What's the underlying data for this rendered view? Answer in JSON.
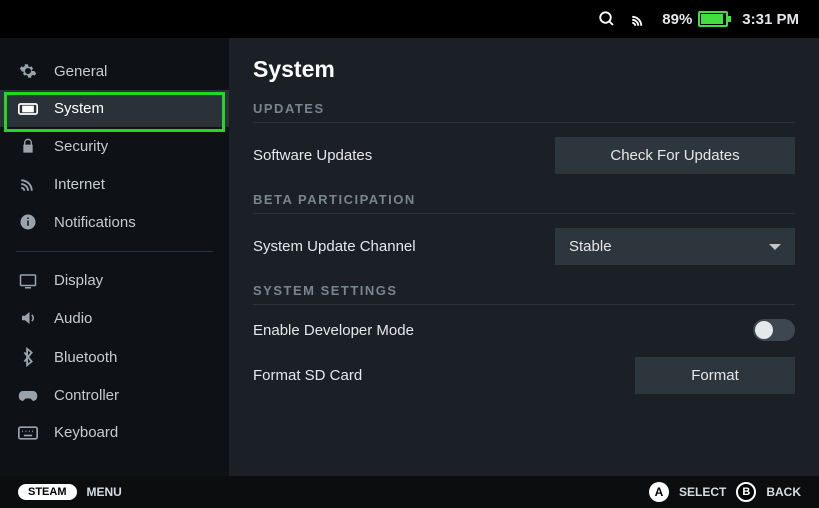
{
  "status": {
    "battery_pct": "89%",
    "time": "3:31 PM"
  },
  "sidebar": {
    "items": [
      {
        "label": "General"
      },
      {
        "label": "System"
      },
      {
        "label": "Security"
      },
      {
        "label": "Internet"
      },
      {
        "label": "Notifications"
      },
      {
        "label": "Display"
      },
      {
        "label": "Audio"
      },
      {
        "label": "Bluetooth"
      },
      {
        "label": "Controller"
      },
      {
        "label": "Keyboard"
      }
    ]
  },
  "page": {
    "title": "System",
    "sections": {
      "updates": {
        "header": "UPDATES",
        "software_updates_label": "Software Updates",
        "check_btn": "Check For Updates"
      },
      "beta": {
        "header": "BETA PARTICIPATION",
        "channel_label": "System Update Channel",
        "channel_value": "Stable"
      },
      "system_settings": {
        "header": "SYSTEM SETTINGS",
        "dev_mode_label": "Enable Developer Mode",
        "dev_mode_value": false,
        "format_sd_label": "Format SD Card",
        "format_btn": "Format"
      }
    }
  },
  "footer": {
    "steam_label": "STEAM",
    "menu_label": "MENU",
    "a_label": "SELECT",
    "b_label": "BACK"
  }
}
